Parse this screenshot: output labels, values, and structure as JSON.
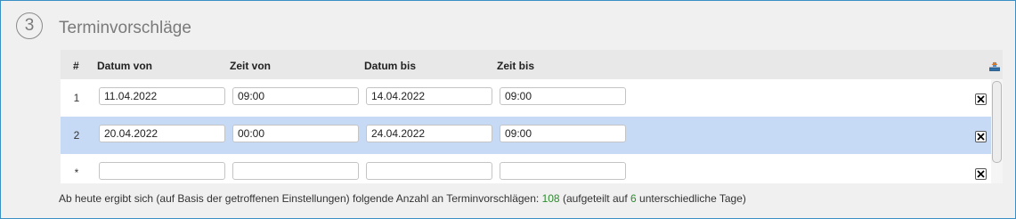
{
  "section": {
    "step_number": "3",
    "title": "Terminvorschläge"
  },
  "table": {
    "columns": [
      "#",
      "Datum von",
      "Zeit von",
      "Datum bis",
      "Zeit bis"
    ],
    "rows": [
      {
        "num": "1",
        "datum_von": "11.04.2022",
        "zeit_von": "09:00",
        "datum_bis": "14.04.2022",
        "zeit_bis": "09:00",
        "selected": false
      },
      {
        "num": "2",
        "datum_von": "20.04.2022",
        "zeit_von": "00:00",
        "datum_bis": "24.04.2022",
        "zeit_bis": "09:00",
        "selected": true
      },
      {
        "num": "*",
        "datum_von": "",
        "zeit_von": "",
        "datum_bis": "",
        "zeit_bis": "",
        "selected": false
      }
    ]
  },
  "summary": {
    "text_before": "Ab heute ergibt sich (auf Basis der getroffenen Einstellungen) folgende Anzahl an Terminvorschlägen: ",
    "count": "108",
    "text_middle": " (aufgeteilt auf ",
    "days": "6",
    "text_after": " unterschiedliche Tage)"
  },
  "colors": {
    "frame_border": "#3a8fc4",
    "selected_row": "#c6daf6",
    "highlight_number": "#2e8b2e"
  },
  "icons": {
    "header_action": "export-icon",
    "row_action": "delete-icon"
  }
}
